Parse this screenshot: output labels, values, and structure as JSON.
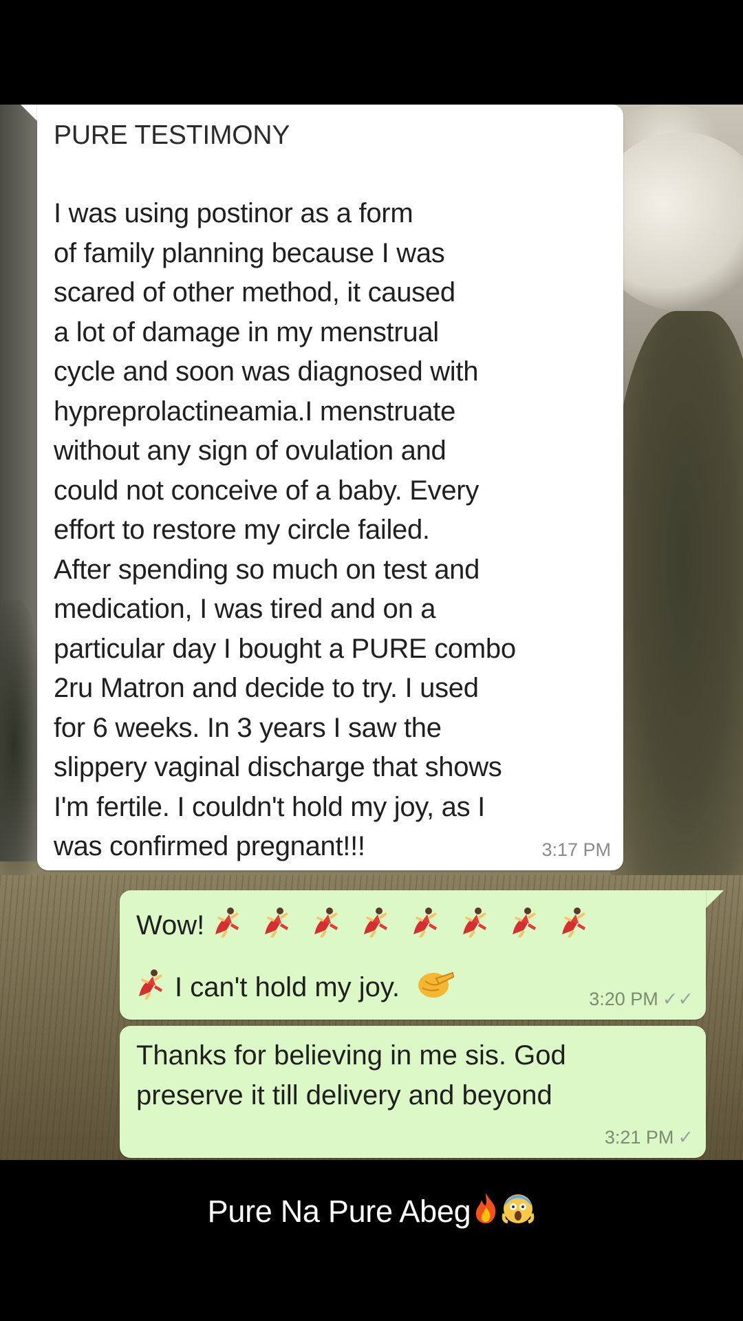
{
  "incoming_message": {
    "title": "PURE TESTIMONY",
    "body_lines": [
      "I was using postinor as a form",
      "of family planning because I was",
      "scared of other method, it caused",
      "a lot of damage in my menstrual",
      "cycle and soon was diagnosed with",
      "hypreprolactineamia.I menstruate",
      "without any sign of ovulation and",
      "could not conceive of a baby. Every",
      "effort to restore my circle failed.",
      "After spending so much on test and",
      "medication, I was tired and on a",
      "particular day I bought a PURE combo",
      "2ru Matron and decide to try. I used",
      "for 6 weeks. In 3 years I saw the",
      "slippery vaginal discharge that shows",
      "I'm fertile. I couldn't hold my joy, as I",
      "was confirmed pregnant!!!"
    ],
    "time": "3:17 PM"
  },
  "outgoing_message_1": {
    "line1_text": "Wow!",
    "line2_text": "I can't hold my joy.",
    "time": "3:20 PM",
    "status": "✓✓",
    "emoji_names": [
      "dancer-emoji",
      "pinching-hand-emoji"
    ]
  },
  "outgoing_message_2": {
    "line1": "Thanks for believing in me sis. God",
    "line2": "preserve it till delivery and beyond",
    "time": "3:21 PM",
    "status": "✓"
  },
  "caption": {
    "text": "Pure Na Pure Abeg",
    "emoji_names": [
      "fire-emoji",
      "screaming-face-emoji"
    ]
  },
  "colors": {
    "incoming_bubble": "#ffffff",
    "outgoing_bubble": "#dcf8c6",
    "background_bars": "#000000"
  }
}
